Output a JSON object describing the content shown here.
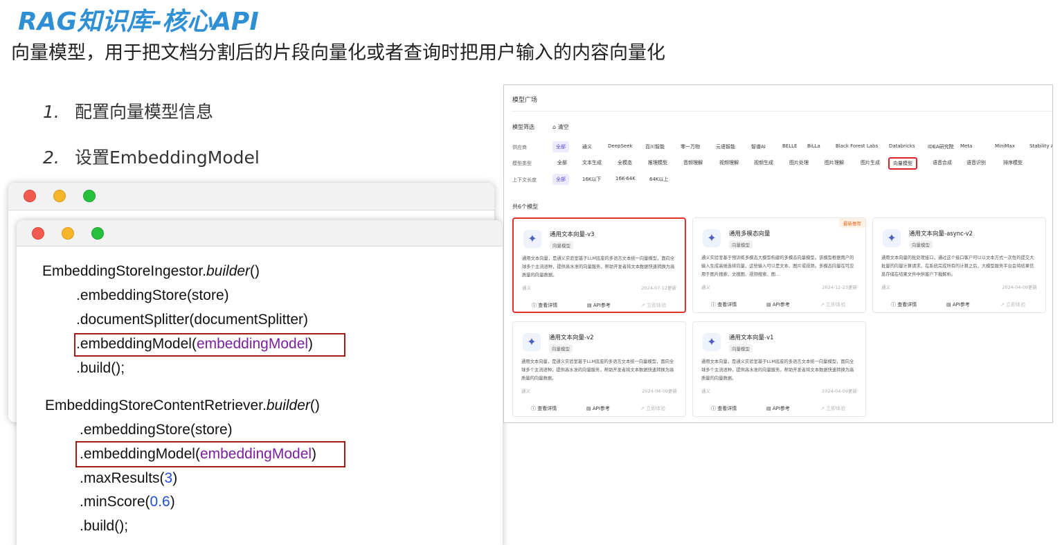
{
  "header": {
    "title": "RAG知识库-核心API",
    "subtitle": "向量模型，用于把文档分割后的片段向量化或者查询时把用户输入的内容向量化"
  },
  "steps": [
    {
      "num": "1.",
      "text": "配置向量模型信息"
    },
    {
      "num": "2.",
      "text": "设置EmbeddingModel"
    }
  ],
  "code": {
    "ingestor": {
      "l1_prefix": "EmbeddingStoreIngestor.",
      "l1_method": "builder",
      "l1_suffix": "()",
      "l2": ".embeddingStore(store)",
      "l3": ".documentSplitter(documentSplitter)",
      "l4_prefix": ".embeddingModel(",
      "l4_arg": "embeddingModel",
      "l4_suffix": ")",
      "l5": ".build();"
    },
    "retriever": {
      "l1_prefix": "EmbeddingStoreContentRetriever.",
      "l1_method": "builder",
      "l1_suffix": "()",
      "l2": ".embeddingStore(store)",
      "l3_prefix": ".embeddingModel(",
      "l3_arg": "embeddingModel",
      "l3_suffix": ")",
      "l4_prefix": ".maxResults(",
      "l4_arg": "3",
      "l4_suffix": ")",
      "l5_prefix": ".minScore(",
      "l5_arg": "0.6",
      "l5_suffix": ")",
      "l6": ".build();"
    }
  },
  "panel": {
    "title": "模型广场",
    "filter_label": "模型筛选",
    "clear_label": "清空",
    "provider_label": "供应商",
    "providers": [
      "全部",
      "通义",
      "DeepSeek",
      "百川智能",
      "零一万物",
      "元语智能",
      "智谱AI",
      "BELLE",
      "BiLLa",
      "Black Forest Labs",
      "Databricks",
      "IDEA研究院",
      "Meta",
      "MiniMax",
      "Stability AI"
    ],
    "type_label": "模型类型",
    "types": [
      "全部",
      "文本生成",
      "全模态",
      "推理模型",
      "音频理解",
      "视频理解",
      "视频生成",
      "图片处理",
      "图片理解",
      "图片生成",
      "向量模型",
      "语音合成",
      "语音识别",
      "排序模型"
    ],
    "context_label": "上下文长度",
    "contexts": [
      "全部",
      "16K以下",
      "16K-64K",
      "64K以上"
    ],
    "count_text": "共6个模型",
    "cards": [
      {
        "name": "通用文本向量-v3",
        "tag": "向量模型",
        "desc": "通用文本向量，是通义实验室基于LLM底座的多语言文本统一向量模型，面向全球多个主流语种，提供高水准的向量服务，帮助开发者将文本数据快速转换为高质量的向量数据。",
        "vendor": "通义",
        "date": "2024-07-12更新",
        "badge": ""
      },
      {
        "name": "通用多模态向量",
        "tag": "向量模型",
        "desc": "通义实验室基于预训练多模态大模型构建的多模态向量模型。该模型根据用户的输入生成高维连续向量，这些输入可以是文本、图片或视频。多模态向量在可应用于图片搜索、文搜图、视频搜索、图...",
        "vendor": "通义",
        "date": "2024-12-23更新",
        "badge": "最新推荐"
      },
      {
        "name": "通用文本向量-async-v2",
        "tag": "向量模型",
        "desc": "通用文本向量的批处理接口，通过这个接口客户可以以文本方式一次性的提交大批量的向量计算请求，在系统完成所有的计算之后，大模型服务平台会将结果信息存储在结果文件中供客户下载解析。",
        "vendor": "通义",
        "date": "2024-04-09更新",
        "badge": ""
      },
      {
        "name": "通用文本向量-v2",
        "tag": "向量模型",
        "desc": "通用文本向量，是通义实验室基于LLM底座的多语言文本统一向量模型，面向全球多个主流语种，提供高水准的向量服务，帮助开发者将文本数据快速转换为高质量的向量数据。",
        "vendor": "通义",
        "date": "2024-04-09更新",
        "badge": ""
      },
      {
        "name": "通用文本向量-v1",
        "tag": "向量模型",
        "desc": "通用文本向量，是通义实验室基于LLM底座的多语言文本统一向量模型，面向全球多个主流语种，提供高水准的向量服务，帮助开发者将文本数据快速转换为高质量的向量数据。",
        "vendor": "通义",
        "date": "2024-04-09更新",
        "badge": ""
      }
    ],
    "actions": {
      "detail": "查看详情",
      "api": "API参考",
      "try": "立即体验"
    },
    "icons": {
      "card_logo": "tongyi-logo-icon",
      "detail": "info-icon",
      "api": "doc-icon",
      "try": "arrow-up-right-icon",
      "clear": "broom-icon"
    },
    "colors": {
      "accent": "#5b4ad3",
      "highlight_box": "#d8232a",
      "title_blue": "#2e8fd4"
    }
  }
}
